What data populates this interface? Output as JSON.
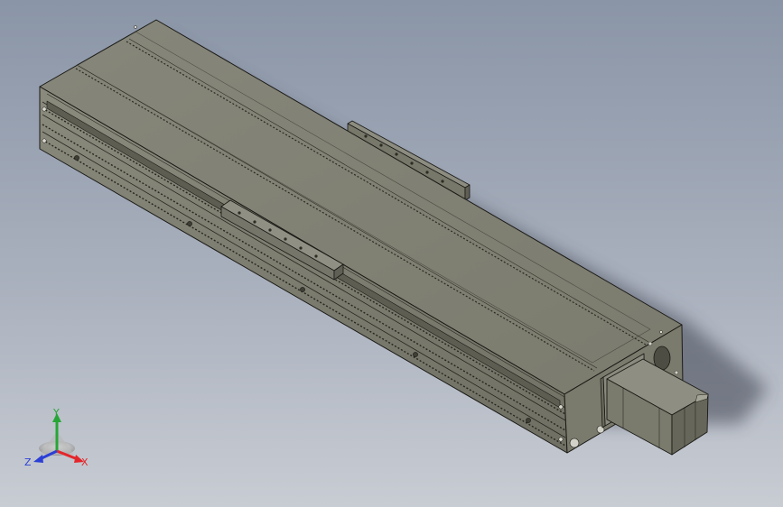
{
  "viewport": {
    "background_top": "#8d98a9",
    "background_bottom": "#c6cad2",
    "model_color": "#7f7f70",
    "edge_color": "#1a1a16"
  },
  "triad": {
    "x_label": "X",
    "y_label": "Y",
    "z_label": "Z",
    "x_color": "#e3262b",
    "y_color": "#27a637",
    "z_color": "#2b3fd6"
  },
  "icons": {
    "model": "linear-actuator-model",
    "motor": "stepper-motor",
    "triad": "coordinate-triad-icon"
  }
}
